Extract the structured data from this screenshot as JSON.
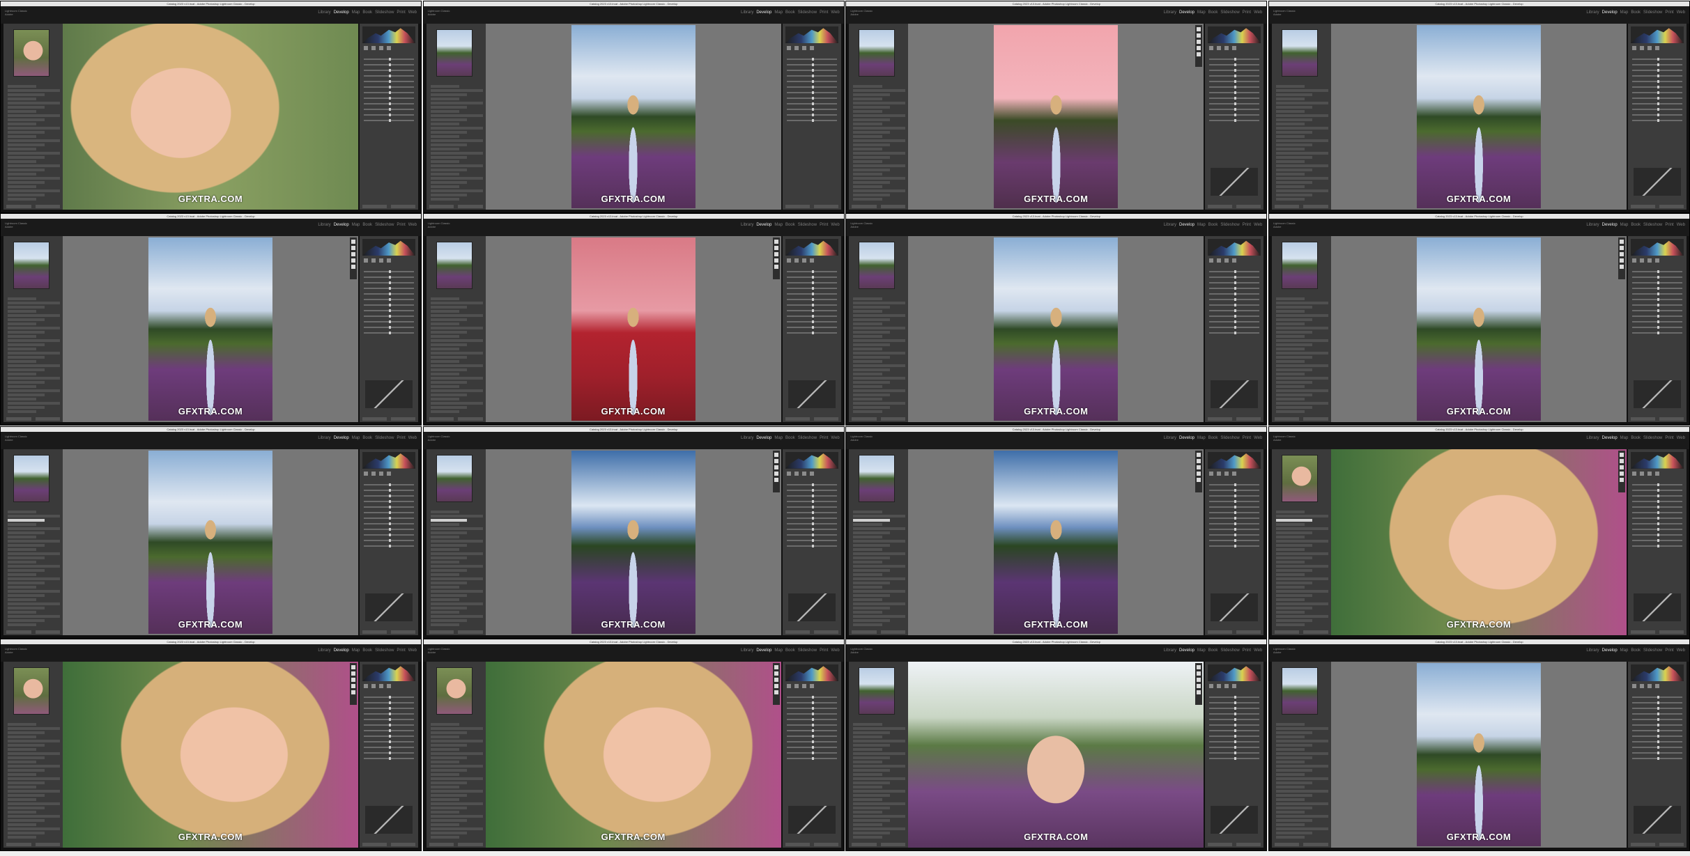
{
  "app": {
    "title_bar": "Catalog 2023 v13.lrcat - Adobe Photoshop Lightroom Classic - Develop",
    "identity_plate": [
      "Lightroom Classic",
      "Adobe"
    ],
    "modules": [
      "Library",
      "Develop",
      "Map",
      "Book",
      "Slideshow",
      "Print",
      "Web"
    ],
    "active_module": "Develop",
    "watermark": "GFXTRA.COM"
  },
  "frames": [
    {
      "view": "face"
    },
    {
      "view": "field"
    },
    {
      "view": "field-pink-mask"
    },
    {
      "view": "field"
    },
    {
      "view": "field"
    },
    {
      "view": "field-red-mask"
    },
    {
      "view": "field"
    },
    {
      "view": "field"
    },
    {
      "view": "field"
    },
    {
      "view": "field-deep-sky"
    },
    {
      "view": "field-deep-sky"
    },
    {
      "view": "face-closeup"
    },
    {
      "view": "face-closeup"
    },
    {
      "view": "face-closeup"
    },
    {
      "view": "portrait-wide"
    },
    {
      "view": "field"
    }
  ]
}
